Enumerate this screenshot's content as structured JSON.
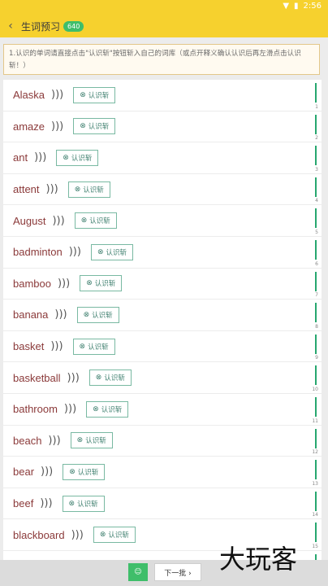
{
  "status": {
    "time": "2:56"
  },
  "header": {
    "back_icon": "chevron-left-icon",
    "title": "生词预习",
    "badge": "640"
  },
  "notice": {
    "text": "1.认识的单词请直接点击\"认识斩\"按钮斩入自己的词库（或点开释义确认认识后再左滑点击认识斩！）"
  },
  "list": {
    "button_label": "认识斩",
    "items": [
      {
        "word": "Alaska",
        "num": "1"
      },
      {
        "word": "amaze",
        "num": "2"
      },
      {
        "word": "ant",
        "num": "3"
      },
      {
        "word": "attent",
        "num": "4"
      },
      {
        "word": "August",
        "num": "5"
      },
      {
        "word": "badminton",
        "num": "6"
      },
      {
        "word": "bamboo",
        "num": "7"
      },
      {
        "word": "banana",
        "num": "8"
      },
      {
        "word": "basket",
        "num": "9"
      },
      {
        "word": "basketball",
        "num": "10"
      },
      {
        "word": "bathroom",
        "num": "11"
      },
      {
        "word": "beach",
        "num": "12"
      },
      {
        "word": "bear",
        "num": "13"
      },
      {
        "word": "beef",
        "num": "14"
      },
      {
        "word": "blackboard",
        "num": "15"
      },
      {
        "word": "",
        "num": ""
      }
    ]
  },
  "footer": {
    "home_label": "☺",
    "next_label": "下一批 ›"
  },
  "watermark": "大玩客"
}
